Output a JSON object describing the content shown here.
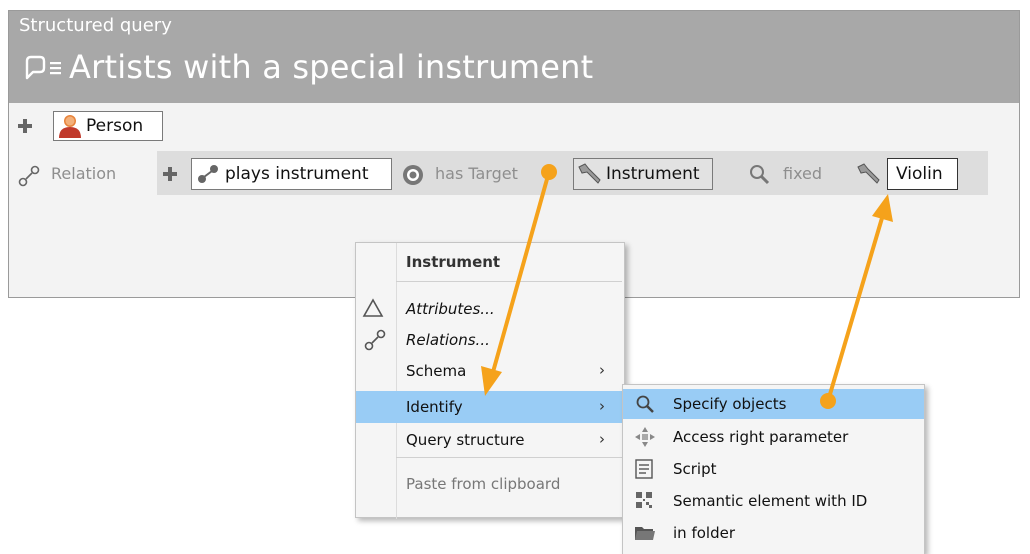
{
  "header": {
    "subtitle": "Structured query",
    "title": "Artists with a special instrument"
  },
  "query": {
    "person_label": "Person",
    "relation_label": "Relation",
    "relation_value": "plays instrument",
    "has_target_label": "has Target",
    "instrument_label": "Instrument",
    "fixed_label": "fixed",
    "violin_value": "Violin"
  },
  "context_menu": {
    "header": "Instrument",
    "items": [
      {
        "label": "Attributes...",
        "icon": "triangle-icon"
      },
      {
        "label": "Relations...",
        "icon": "relation-icon"
      },
      {
        "label": "Schema",
        "submenu": true
      },
      {
        "label": "Identify",
        "submenu": true,
        "highlighted": true
      },
      {
        "label": "Query structure",
        "submenu": true
      },
      {
        "label": "Paste from clipboard",
        "disabled": true
      }
    ]
  },
  "submenu": {
    "items": [
      {
        "label": "Specify objects",
        "icon": "search-icon",
        "highlighted": true
      },
      {
        "label": "Access right parameter",
        "icon": "access-right-icon"
      },
      {
        "label": "Script",
        "icon": "script-icon"
      },
      {
        "label": "Semantic element with ID",
        "icon": "qr-code-icon"
      },
      {
        "label": "in folder",
        "icon": "folder-icon"
      }
    ]
  },
  "colors": {
    "title_bar": "#a8a8a8",
    "highlight": "#99ccf5",
    "arrow": "#f5a21b",
    "relation_band": "#dddddd"
  }
}
